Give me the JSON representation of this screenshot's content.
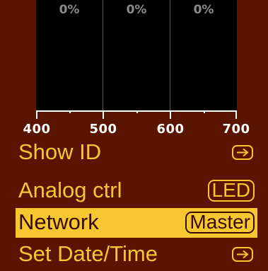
{
  "spectrum": {
    "bands": [
      {
        "percent": "0%"
      },
      {
        "percent": "0%"
      },
      {
        "percent": "0%"
      }
    ],
    "axis_labels": [
      "400",
      "500",
      "600",
      "700"
    ]
  },
  "menu": {
    "items": [
      {
        "label": "Show ID",
        "control": "arrow-icon"
      },
      {
        "label": "Analog ctrl",
        "value": "LED"
      },
      {
        "label": "Network",
        "value": "Master",
        "selected": true
      },
      {
        "label": "Set Date/Time",
        "control": "arrow-icon"
      }
    ]
  },
  "colors": {
    "background": "#5a1500",
    "accent": "#f6c731",
    "selected_text": "#3a0c00",
    "panel": "#000000"
  }
}
